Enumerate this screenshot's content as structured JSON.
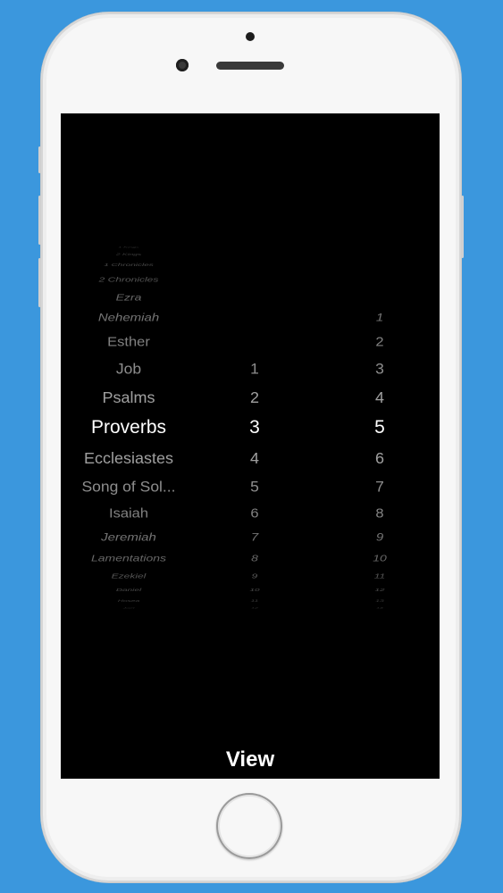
{
  "picker": {
    "books": [
      "1 Kings",
      "2 Kings",
      "1 Chronicles",
      "2 Chronicles",
      "Ezra",
      "Nehemiah",
      "Esther",
      "Job",
      "Psalms",
      "Proverbs",
      "Ecclesiastes",
      "Song of Sol...",
      "Isaiah",
      "Jeremiah",
      "Lamentations",
      "Ezekiel",
      "Daniel",
      "Hosea",
      "Joel"
    ],
    "chapters": [
      "",
      "",
      "",
      "",
      "",
      "",
      "",
      "1",
      "2",
      "3",
      "4",
      "5",
      "6",
      "7",
      "8",
      "9",
      "10",
      "11",
      "12"
    ],
    "verses": [
      "",
      "",
      "",
      "",
      "",
      "1",
      "2",
      "3",
      "4",
      "5",
      "6",
      "7",
      "8",
      "9",
      "10",
      "11",
      "12",
      "13",
      "14"
    ],
    "selected_book": "Proverbs",
    "selected_chapter": "3",
    "selected_verse": "5"
  },
  "footer": {
    "view_label": "View"
  }
}
